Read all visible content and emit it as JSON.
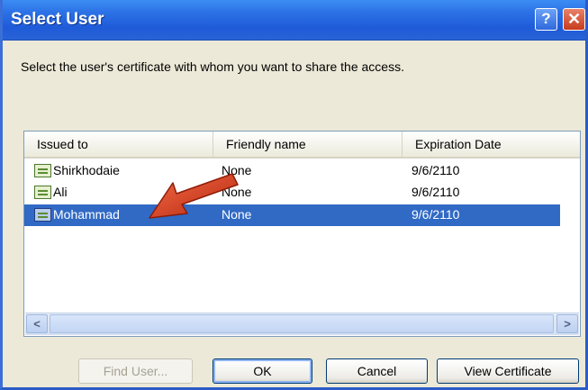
{
  "dialog": {
    "title": "Select User",
    "help_glyph": "?",
    "close_glyph": "✕",
    "instruction": "Select the user's certificate with whom you want to share the access."
  },
  "list": {
    "columns": [
      "Issued to",
      "Friendly name",
      "Expiration Date"
    ],
    "rows": [
      {
        "issued_to": "Shirkhodaie",
        "friendly_name": "None",
        "expiration": "9/6/2110",
        "selected": false
      },
      {
        "issued_to": "Ali",
        "friendly_name": "None",
        "expiration": "9/6/2110",
        "selected": false
      },
      {
        "issued_to": "Mohammad",
        "friendly_name": "None",
        "expiration": "9/6/2110",
        "selected": true
      }
    ],
    "scroll_left_glyph": "<",
    "scroll_right_glyph": ">"
  },
  "buttons": {
    "find_user": "Find User...",
    "ok": "OK",
    "cancel": "Cancel",
    "view_certificate": "View Certificate"
  },
  "colors": {
    "titlebar": "#2a6fe4",
    "selection": "#316ac5",
    "annotation_arrow": "#d83a1c"
  },
  "icons": {
    "row_icon": "certificate-icon",
    "annotation": "red-arrow-annotation"
  }
}
